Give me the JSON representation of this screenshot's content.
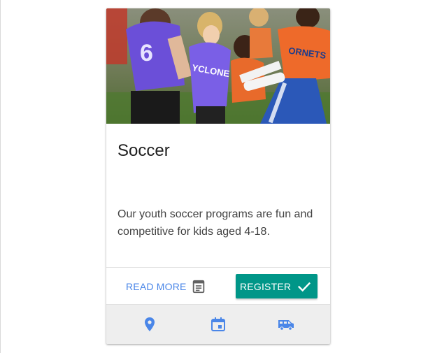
{
  "card": {
    "title": "Soccer",
    "description": "Our youth soccer programs are fun and competitive for kids aged 4-18.",
    "image_alt": "kids playing soccer"
  },
  "actions": {
    "read_more_label": "READ MORE",
    "read_more_icon": "description-icon",
    "register_label": "REGISTER",
    "register_icon": "check-icon"
  },
  "footer": {
    "icons": [
      "location-pin-icon",
      "calendar-icon",
      "van-icon"
    ]
  },
  "colors": {
    "accent": "#009688",
    "link": "#4a86e8",
    "footer_bg": "#eeeeee"
  }
}
